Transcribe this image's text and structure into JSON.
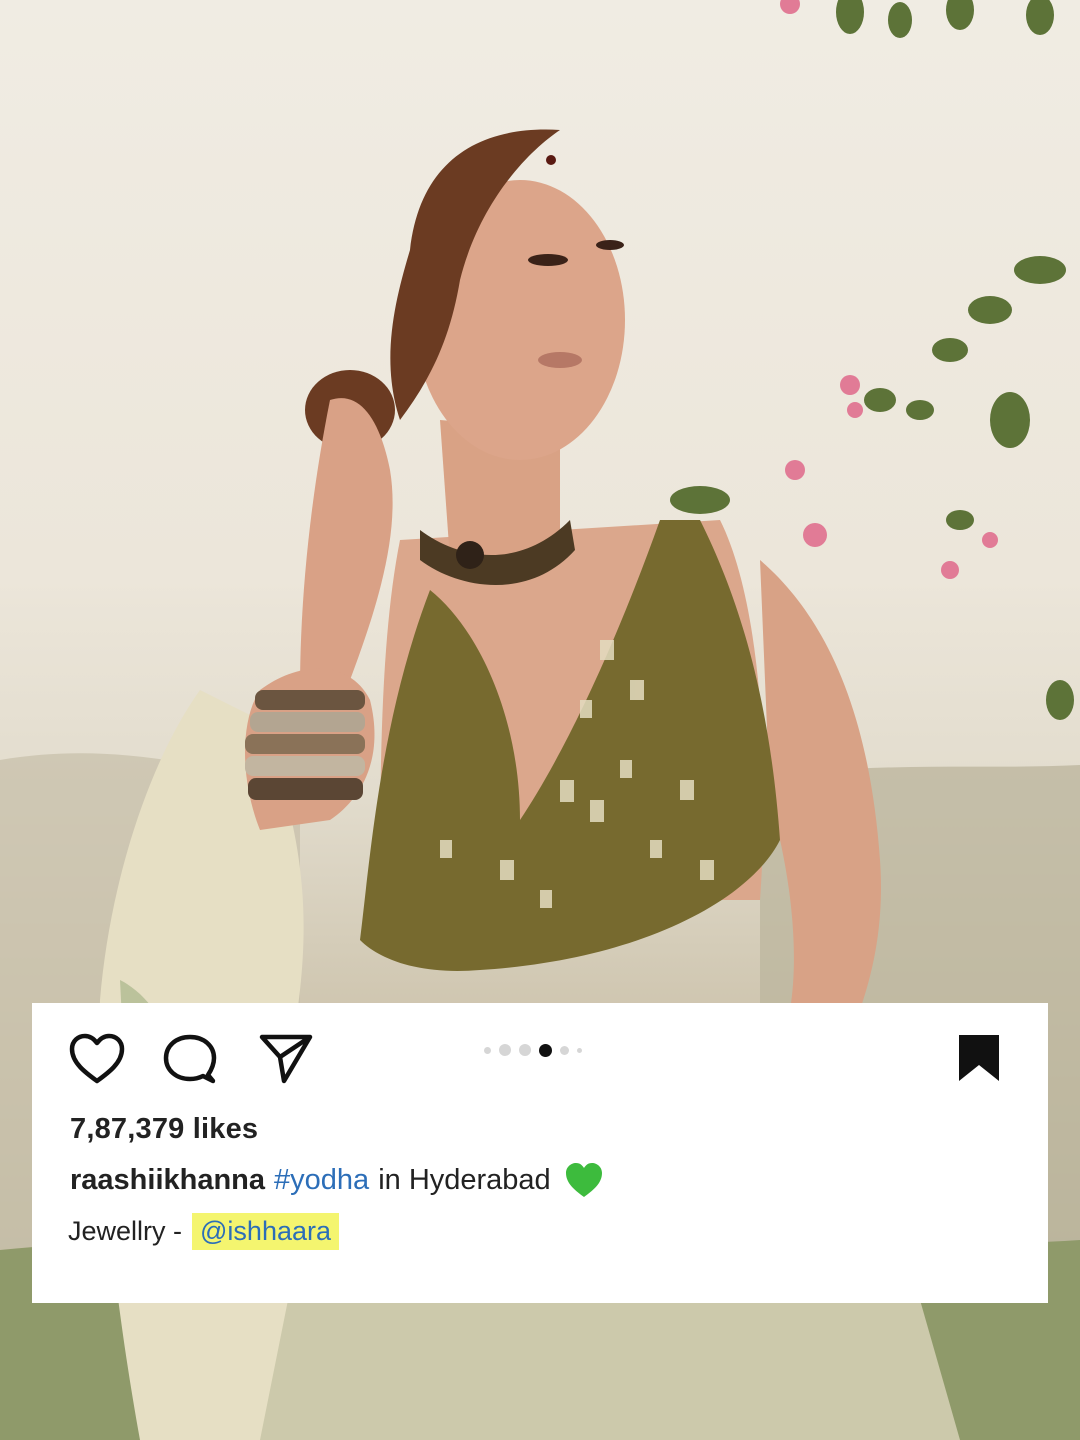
{
  "post": {
    "photo_alt": "Woman in olive mirror-work blouse with choker and bangles, outdoors",
    "carousel": {
      "count": 6,
      "active_index": 3
    },
    "likes_text": "7,87,379 likes",
    "caption": {
      "username": "raashiikhanna",
      "hashtag": "#yodha",
      "text": "in Hyderabad",
      "emoji": "green-heart"
    },
    "credit": {
      "label": "Jewellry -",
      "mention": "@ishhaara"
    },
    "icons": {
      "like": "heart-outline-icon",
      "comment": "comment-bubble-icon",
      "share": "paper-plane-icon",
      "save": "bookmark-filled-icon"
    },
    "colors": {
      "hashtag": "#2c6eb8",
      "mention_highlight": "#f4f56f",
      "emoji_heart": "#3dbb3d"
    }
  }
}
